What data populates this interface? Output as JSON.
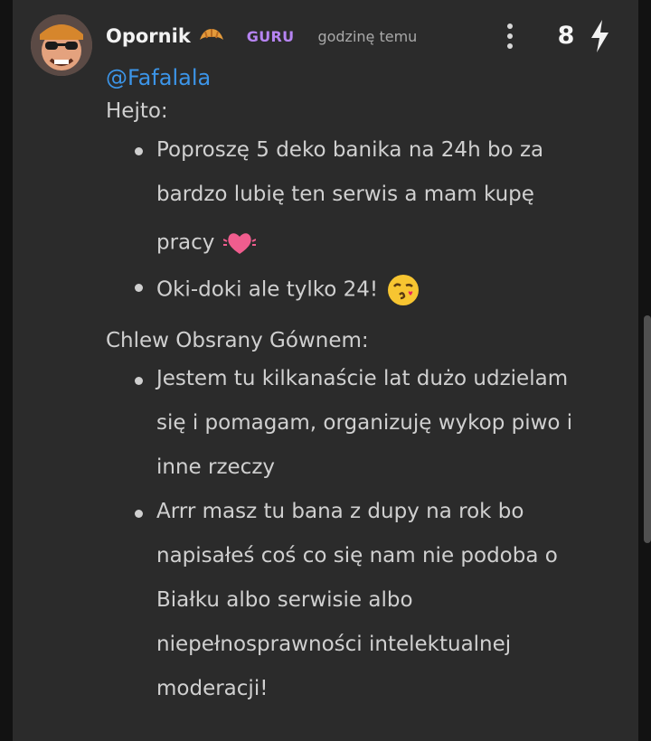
{
  "comment": {
    "author": "Opornik",
    "author_badge_icon": "croissant-icon",
    "rank": "GURU",
    "time": "godzinę temu",
    "votes": "8",
    "mention": "@Fafalala",
    "section1_title": "Hejto:",
    "section1_items": [
      {
        "lines": [
          "Poproszę 5 deko banika na 24h bo za",
          "bardzo lubię ten serwis a mam kupę",
          "pracy"
        ],
        "emoji": "sparkling-heart-emoji"
      },
      {
        "lines": [
          "Oki-doki ale tylko 24!"
        ],
        "emoji": "face-blowing-kiss-emoji"
      }
    ],
    "section2_title": "Chlew Obsrany Gównem:",
    "section2_items": [
      {
        "lines": [
          "Jestem tu kilkanaście lat dużo udzielam",
          "się i pomagam, organizuję wykop piwo i",
          "inne rzeczy"
        ]
      },
      {
        "lines": [
          "Arrr masz tu bana z dupy na rok bo",
          "napisałeś coś co się nam nie podoba o",
          "Białku albo serwisie albo",
          "niepełnosprawności intelektualnej",
          "moderacji!"
        ]
      }
    ]
  },
  "colors": {
    "background": "#121212",
    "card": "#2b2b2b",
    "text": "#d0d0d0",
    "mention": "#3c95e8",
    "rank": "#b684f2"
  }
}
